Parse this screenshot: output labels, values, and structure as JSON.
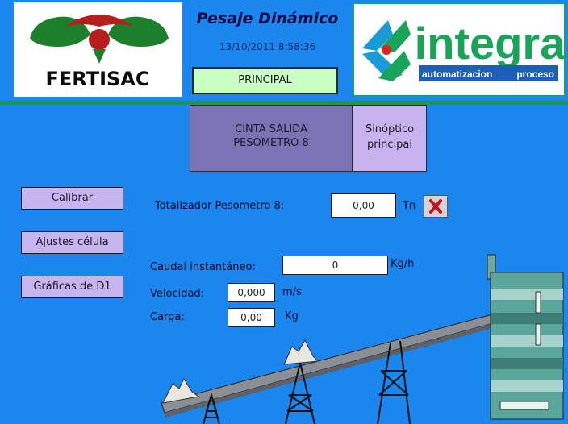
{
  "header": {
    "title": "Pesaje Dinámico",
    "timestamp": "13/10/2011 8:58:36",
    "principal_label": "PRINCIPAL",
    "logo_left_text": "FERTISAC",
    "logo_right_text": "integra",
    "logo_right_sub_left": "automatizacion",
    "logo_right_sub_right": "proceso"
  },
  "section": {
    "title_line1": "CINTA SALIDA",
    "title_line2": "PESÓMETRO 8",
    "sinoptico_line1": "Sinóptico",
    "sinoptico_line2": "principal"
  },
  "side_buttons": {
    "calibrar": "Calibrar",
    "ajustes": "Ajustes célula",
    "graficas": "Gráficas de D1"
  },
  "totalizer": {
    "label": "Totalizador Pesometro 8:",
    "value": "0,00",
    "unit": "Tn"
  },
  "readings": {
    "caudal_label": "Caudal instantáneo:",
    "caudal_value": "0",
    "caudal_unit": "Kg/h",
    "velocidad_label": "Velocidad:",
    "velocidad_value": "0,000",
    "velocidad_unit": "m/s",
    "carga_label": "Carga:",
    "carga_value": "0,00",
    "carga_unit": "Kg"
  },
  "colors": {
    "background": "#1a86ee",
    "header_separator": "#1b9a3c",
    "button_lilac": "#c7b5ef",
    "principal_green": "#c9ffc4",
    "title_box": "#7b74b4"
  }
}
